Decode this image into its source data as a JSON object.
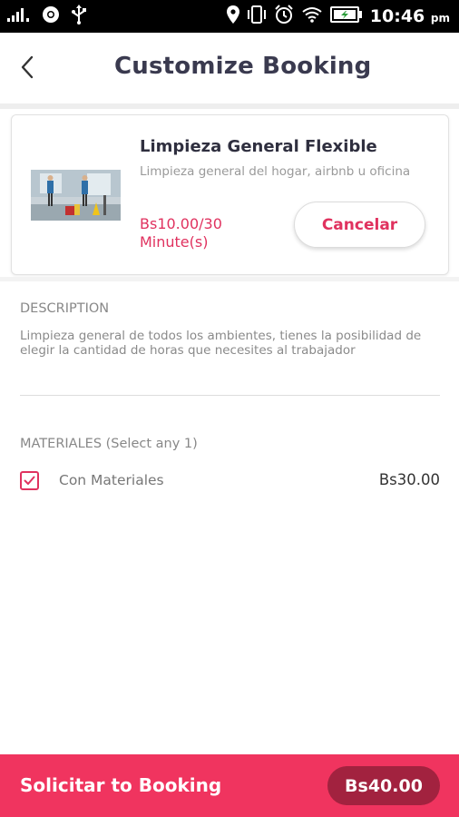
{
  "status_bar": {
    "time": "10:46",
    "ampm": "pm",
    "icons": [
      "signal-icon",
      "chrome-icon",
      "usb-icon",
      "location-icon",
      "vibrate-icon",
      "alarm-icon",
      "wifi-icon",
      "battery-icon"
    ]
  },
  "header": {
    "title": "Customize Booking",
    "back_icon": "chevron-left-icon"
  },
  "service": {
    "name": "Limpieza General Flexible",
    "subtitle": "Limpieza general del hogar, airbnb u oficina",
    "price_line1": "Bs10.00/30",
    "price_line2": "Minute(s)",
    "cancel_label": "Cancelar"
  },
  "description": {
    "heading": "DESCRIPTION",
    "text": "Limpieza general de todos los ambientes, tienes la posibilidad de elegir la cantidad de horas que necesites al trabajador"
  },
  "materials": {
    "heading": "MATERIALES (Select any  1)",
    "items": [
      {
        "label": "Con Materiales",
        "price": "Bs30.00",
        "checked": true
      }
    ]
  },
  "footer": {
    "action_label": "Solicitar to Booking",
    "total": "Bs40.00"
  },
  "colors": {
    "accent": "#e0325f",
    "bottom_bar": "#f0345f",
    "total_pill": "#a2223f",
    "title_text": "#3a3a4f"
  }
}
